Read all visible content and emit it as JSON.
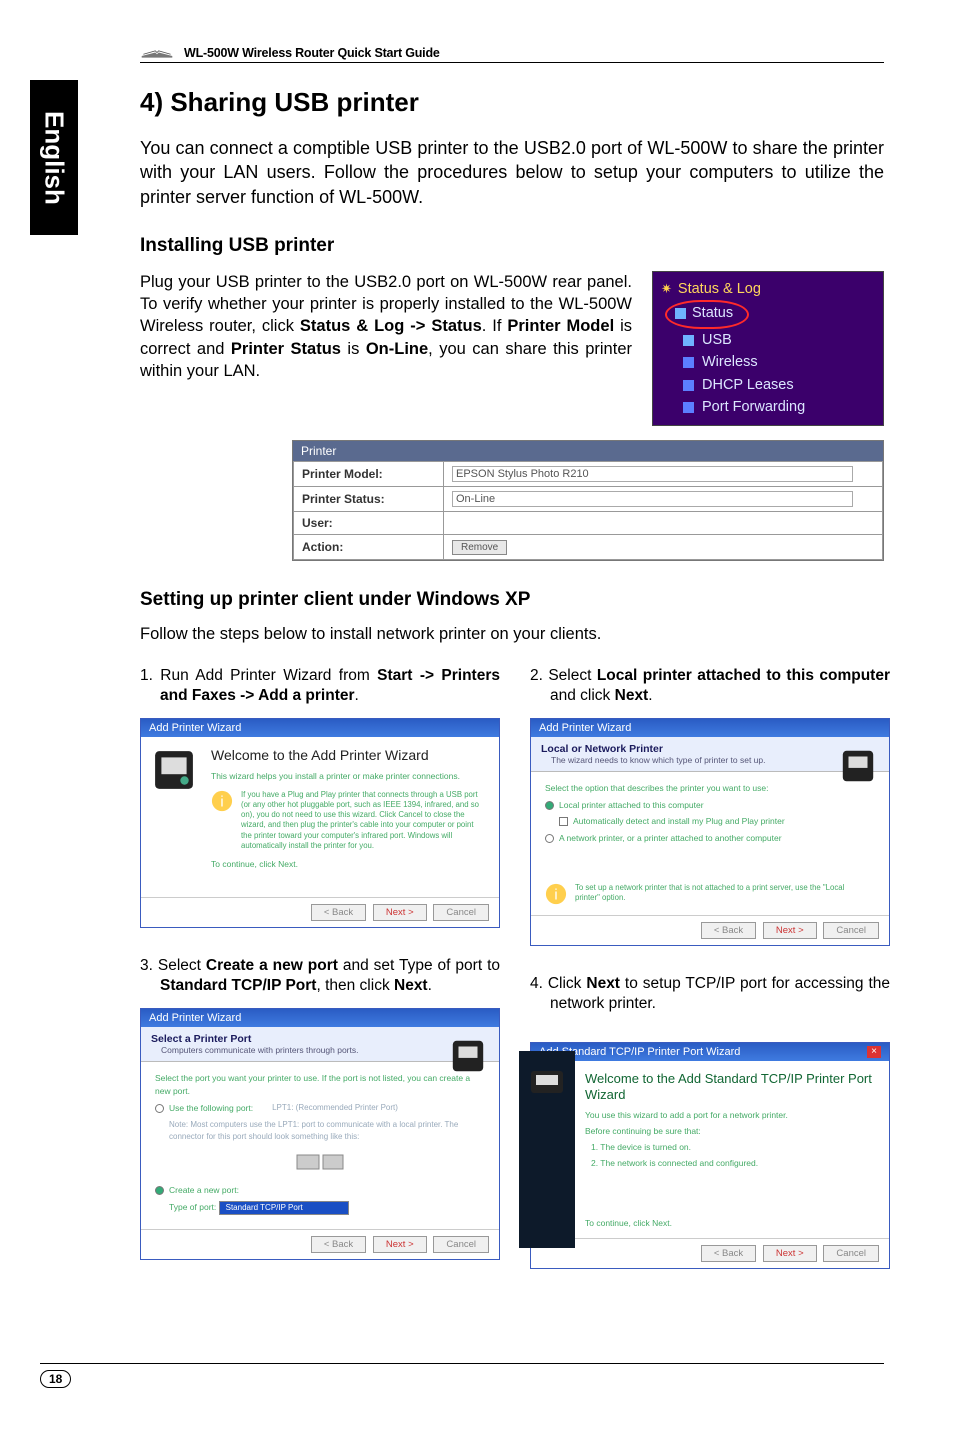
{
  "header": {
    "doc_title": "WL-500W Wireless Router Quick Start Guide"
  },
  "lang_tab": "English",
  "section": {
    "title": "4) Sharing USB printer",
    "lead": "You can connect a comptible USB printer to the USB2.0 port of WL-500W to share the printer with your LAN users. Follow the procedures below to setup your computers to utilize the printer server function of WL-500W."
  },
  "install": {
    "heading": "Installing USB printer",
    "body_pre": "Plug your USB printer to the USB2.0 port on WL-500W rear panel. To verify whether your printer is properly installed to the WL-500W Wireless router, click ",
    "bold1": "Status & Log -> Status",
    "mid1": ". If ",
    "bold2": "Printer Model",
    "mid2": " is correct and ",
    "bold3": "Printer Status",
    "mid3": " is ",
    "bold4": "On-Line",
    "tail": ", you can share this printer within your LAN."
  },
  "menu": {
    "top": "Status & Log",
    "status": "Status",
    "usb": "USB",
    "wireless": "Wireless",
    "dhcp": "DHCP Leases",
    "port": "Port Forwarding"
  },
  "ptable": {
    "head": "Printer",
    "r1l": "Printer Model:",
    "r1v": "EPSON Stylus Photo R210",
    "r2l": "Printer Status:",
    "r2v": "On-Line",
    "r3l": "User:",
    "r3v": "",
    "r4l": "Action:",
    "r4btn": "Remove"
  },
  "setup": {
    "heading": "Setting up printer client under Windows XP",
    "follow": "Follow the steps below to install network printer on your clients."
  },
  "steps": {
    "s1_pre": "1.  Run Add Printer Wizard from ",
    "s1_bold": "Start -> Printers and Faxes -> Add a printer",
    "s1_post": ".",
    "s2_pre": "2.  Select ",
    "s2_bold": "Local printer attached to this computer",
    "s2_mid": " and click ",
    "s2_bold2": "Next",
    "s2_post": ".",
    "s3_pre": "3.  Select ",
    "s3_bold": "Create a new port",
    "s3_mid": " and set Type of port to ",
    "s3_bold2": "Standard TCP/IP Port",
    "s3_mid2": ", then click ",
    "s3_bold3": "Next",
    "s3_post": ".",
    "s4_pre": "4.  Click ",
    "s4_bold": "Next",
    "s4_post": " to setup TCP/IP port for accessing the network printer."
  },
  "wiz1": {
    "title": "Add Printer Wizard",
    "h": "Welcome to the Add Printer Wizard",
    "p1": "This wizard helps you install a printer or make printer connections.",
    "note": "If you have a Plug and Play printer that connects through a USB port (or any other hot pluggable port, such as IEEE 1394, infrared, and so on), you do not need to use this wizard. Click Cancel to close the wizard, and then plug the printer's cable into your computer or point the printer toward your computer's infrared port. Windows will automatically install the printer for you.",
    "continue": "To continue, click Next.",
    "back": "< Back",
    "next": "Next >",
    "cancel": "Cancel"
  },
  "wiz2": {
    "title": "Add Printer Wizard",
    "ht1": "Local or Network Printer",
    "ht2": "The wizard needs to know which type of printer to set up.",
    "line0": "Select the option that describes the printer you want to use:",
    "opt1": "Local printer attached to this computer",
    "chk": "Automatically detect and install my Plug and Play printer",
    "opt2": "A network printer, or a printer attached to another computer",
    "note": "To set up a network printer that is not attached to a print server, use the \"Local printer\" option.",
    "back": "< Back",
    "next": "Next >",
    "cancel": "Cancel"
  },
  "wiz3": {
    "title": "Add Printer Wizard",
    "ht1": "Select a Printer Port",
    "ht2": "Computers communicate with printers through ports.",
    "line0": "Select the port you want your printer to use. If the port is not listed, you can create a new port.",
    "opt1": "Use the following port:",
    "hint1": "LPT1: (Recommended Printer Port)",
    "hint2": "Note: Most computers use the LPT1: port to communicate with a local printer. The connector for this port should look something like this:",
    "opt2": "Create a new port:",
    "type_lbl": "Type of port:",
    "type_val": "Standard TCP/IP Port",
    "back": "< Back",
    "next": "Next >",
    "cancel": "Cancel"
  },
  "wiz4": {
    "title": "Add Standard TCP/IP Printer Port Wizard",
    "h": "Welcome to the Add Standard TCP/IP Printer Port Wizard",
    "p1": "You use this wizard to add a port for a network printer.",
    "p2a": "Before continuing be sure that:",
    "p2b": "1. The device is turned on.",
    "p2c": "2. The network is connected and configured.",
    "continue": "To continue, click Next.",
    "back": "< Back",
    "next": "Next >",
    "cancel": "Cancel"
  },
  "page_number": "18"
}
